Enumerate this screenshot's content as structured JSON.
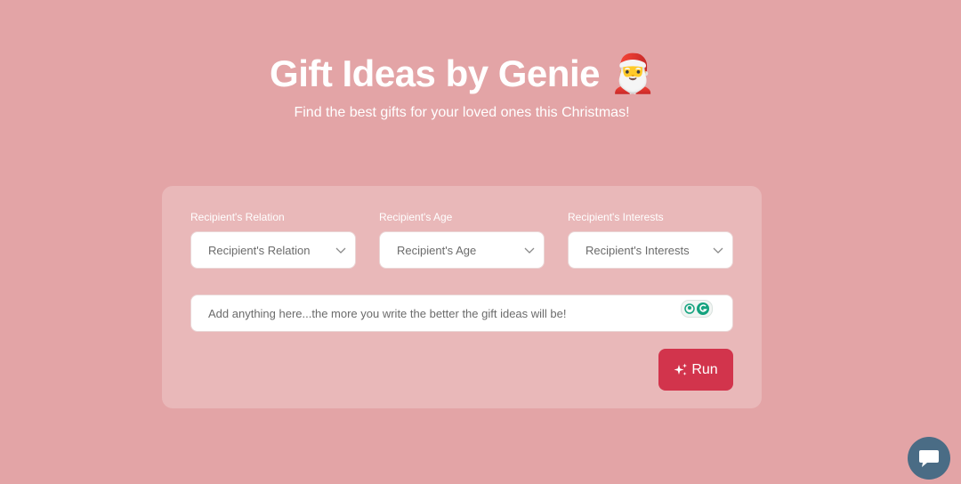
{
  "header": {
    "title": "Gift Ideas by Genie",
    "title_emoji": "🎅",
    "subtitle": "Find the best gifts for your loved ones this Christmas!"
  },
  "form": {
    "fields": [
      {
        "label": "Recipient's Relation",
        "placeholder": "Recipient's Relation"
      },
      {
        "label": "Recipient's Age",
        "placeholder": "Recipient's Age"
      },
      {
        "label": "Recipient's Interests",
        "placeholder": "Recipient's Interests"
      }
    ],
    "notes_placeholder": "Add anything here...the more you write the better the gift ideas will be!",
    "run_label": "Run"
  },
  "icons": {
    "select_chevron": "chevron-down-icon",
    "run": "sparkles-icon",
    "grammarly": "grammarly-icon",
    "chat": "chat-bubble-icon"
  },
  "colors": {
    "background": "#e3a4a6",
    "run_button": "#d2344c",
    "chat_button": "#4a6c85"
  }
}
